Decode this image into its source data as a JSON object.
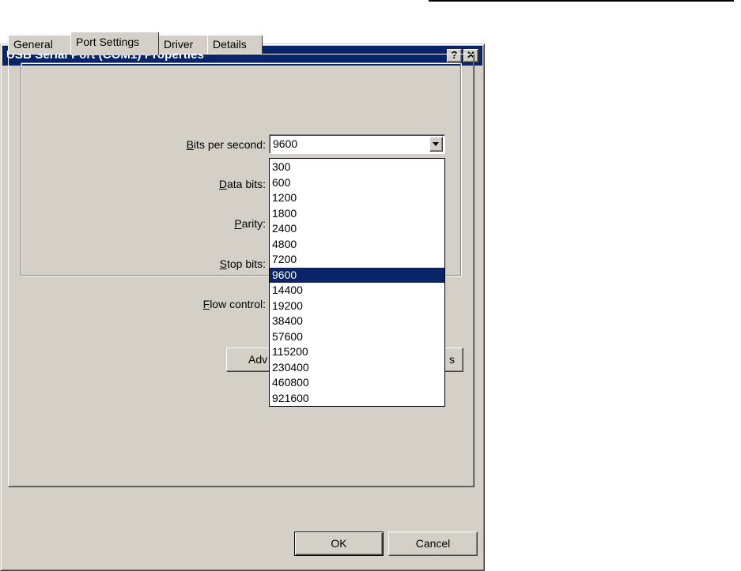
{
  "window": {
    "title": "USB Serial Port (COM1) Properties",
    "help_label": "?",
    "close_label": "✕"
  },
  "tabs": [
    {
      "label": "General",
      "active": false
    },
    {
      "label": "Port Settings",
      "active": true
    },
    {
      "label": "Driver",
      "active": false
    },
    {
      "label": "Details",
      "active": false
    }
  ],
  "fields": {
    "bits_per_second": {
      "key": "B",
      "rest": "its per second:",
      "value": "9600"
    },
    "data_bits": {
      "key": "D",
      "rest": "ata bits:"
    },
    "parity": {
      "key": "P",
      "rest": "arity:"
    },
    "stop_bits": {
      "key": "S",
      "rest": "top bits:"
    },
    "flow_control": {
      "key": "F",
      "rest": "low control:"
    }
  },
  "dropdown": {
    "options": [
      "300",
      "600",
      "1200",
      "1800",
      "2400",
      "4800",
      "7200",
      "9600",
      "14400",
      "19200",
      "38400",
      "57600",
      "115200",
      "230400",
      "460800",
      "921600"
    ],
    "selected": "9600"
  },
  "buttons": {
    "advanced_visible": "Adv",
    "advanced_tail": "s",
    "ok": "OK",
    "cancel": "Cancel"
  }
}
